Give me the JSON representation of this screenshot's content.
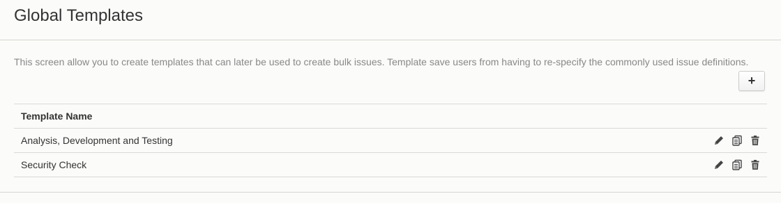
{
  "header": {
    "title": "Global Templates"
  },
  "description": "This screen allow you to create templates that can later be used to create bulk issues. Template save users from having to re-specify the commonly used issue definitions.",
  "toolbar": {
    "add_label": "+",
    "add_icon": "plus-icon"
  },
  "table": {
    "columns": [
      "Template Name",
      ""
    ],
    "rows": [
      {
        "name": "Analysis, Development and Testing",
        "actions": [
          "edit-icon",
          "copy-icon",
          "trash-icon"
        ]
      },
      {
        "name": "Security Check",
        "actions": [
          "edit-icon",
          "copy-icon",
          "trash-icon"
        ]
      }
    ]
  },
  "colors": {
    "background": "#fbfbf9",
    "border": "#d9d9d9",
    "text": "#333333",
    "muted_text": "#888888"
  }
}
